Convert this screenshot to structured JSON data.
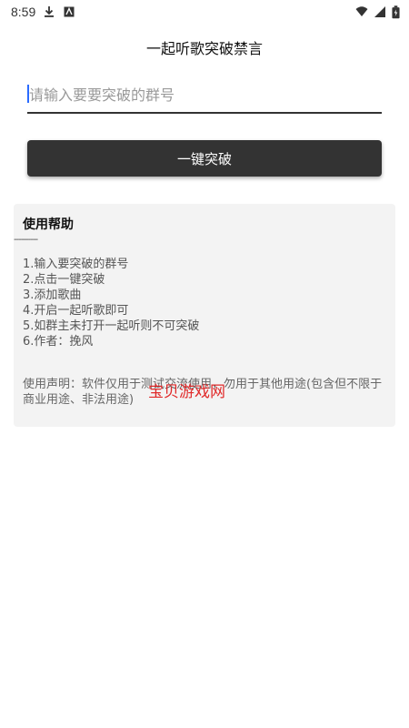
{
  "status_bar": {
    "time": "8:59",
    "icons": [
      "download-icon",
      "notification-a-icon",
      "wifi-icon",
      "signal-icon",
      "battery-icon"
    ]
  },
  "page": {
    "title": "一起听歌突破禁言"
  },
  "group_input": {
    "placeholder": "请输入要要突破的群号",
    "value": ""
  },
  "breach_button": {
    "label": "一键突破"
  },
  "help": {
    "title": "使用帮助",
    "divider": "----------",
    "steps": [
      "1.输入要突破的群号",
      "2.点击一键突破",
      "3.添加歌曲",
      "4.开启一起听歌即可",
      "5.如群主未打开一起听则不可突破",
      "6.作者：挽风"
    ],
    "disclaimer": "使用声明：软件仅用于测试交流使用，勿用于其他用途(包含但不限于商业用途、非法用途)"
  },
  "watermark": {
    "text": "宝贝游戏网"
  },
  "colors": {
    "button_bg": "#333333",
    "card_bg": "#f3f3f3",
    "caret": "#2b6bff",
    "watermark": "#e02020"
  }
}
